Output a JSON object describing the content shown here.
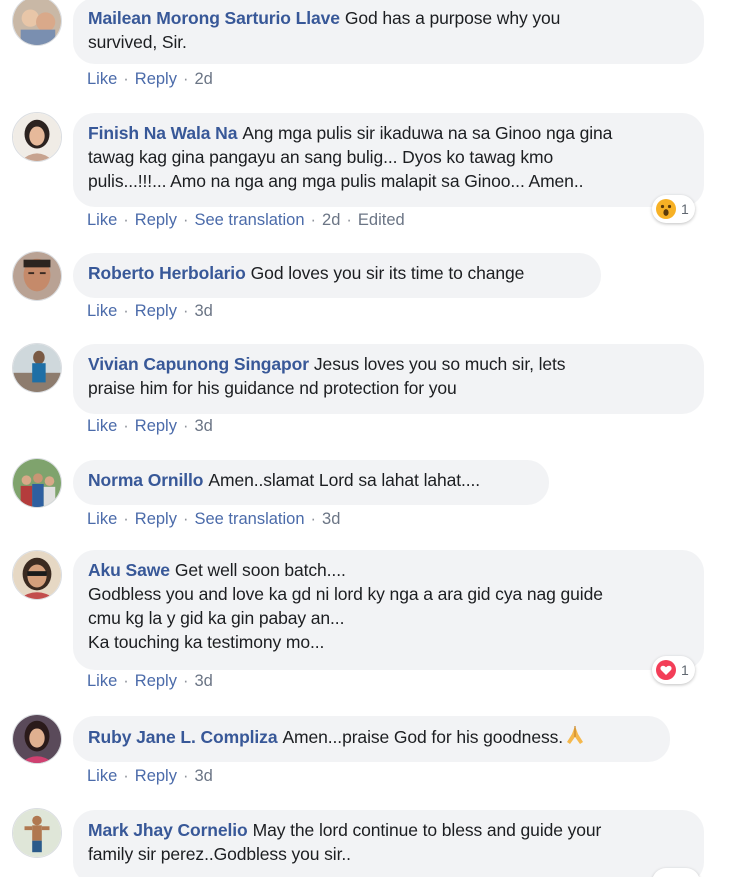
{
  "labels": {
    "like": "Like",
    "reply": "Reply",
    "see_translation": "See translation",
    "dot": "·"
  },
  "comments": [
    {
      "author": "Mailean Morong Sarturio Llave",
      "text": "God has a purpose why you\nsurvived, Sir.",
      "time": "2d"
    },
    {
      "author": "Finish Na Wala Na",
      "text": "Ang mga pulis sir ikaduwa na sa Ginoo nga gina\ntawag kag gina pangayu an sang bulig... Dyos ko tawag kmo\npulis...!!!... Amo na nga ang mga pulis malapit sa Ginoo... Amen..",
      "time": "2d",
      "edited": "Edited",
      "reaction": {
        "icon": "wow-reaction-icon",
        "count": "1"
      }
    },
    {
      "author": "Roberto Herbolario",
      "text": "God loves you sir its time to change",
      "time": "3d"
    },
    {
      "author": "Vivian Capunong Singapor",
      "text": "Jesus loves you so much sir, lets\npraise him for his guidance nd protection for you",
      "time": "3d"
    },
    {
      "author": "Norma Ornillo",
      "text": "Amen..slamat Lord sa lahat lahat....",
      "time": "3d"
    },
    {
      "author": "Aku Sawe",
      "text": "Get well soon batch....\nGodbless you and love ka gd ni lord ky nga a ara gid cya nag guide\ncmu kg la y gid ka gin pabay an...\nKa touching ka testimony mo...",
      "time": "3d",
      "reaction": {
        "icon": "love-reaction-icon",
        "count": "1"
      }
    },
    {
      "author": "Ruby Jane L. Compliza",
      "text": "Amen...praise God for his goodness.",
      "time": "3d",
      "emoji": "praying-hands-icon"
    },
    {
      "author": "Mark Jhay Cornelio",
      "text": "May the lord continue to bless and guide your\nfamily sir perez..Godbless you sir..",
      "time": ""
    }
  ],
  "colors": {
    "name": "#385898",
    "bubble": "#f2f3f5",
    "meta": "#90949c",
    "love": "#f33e58",
    "wow": "#f7b125"
  }
}
